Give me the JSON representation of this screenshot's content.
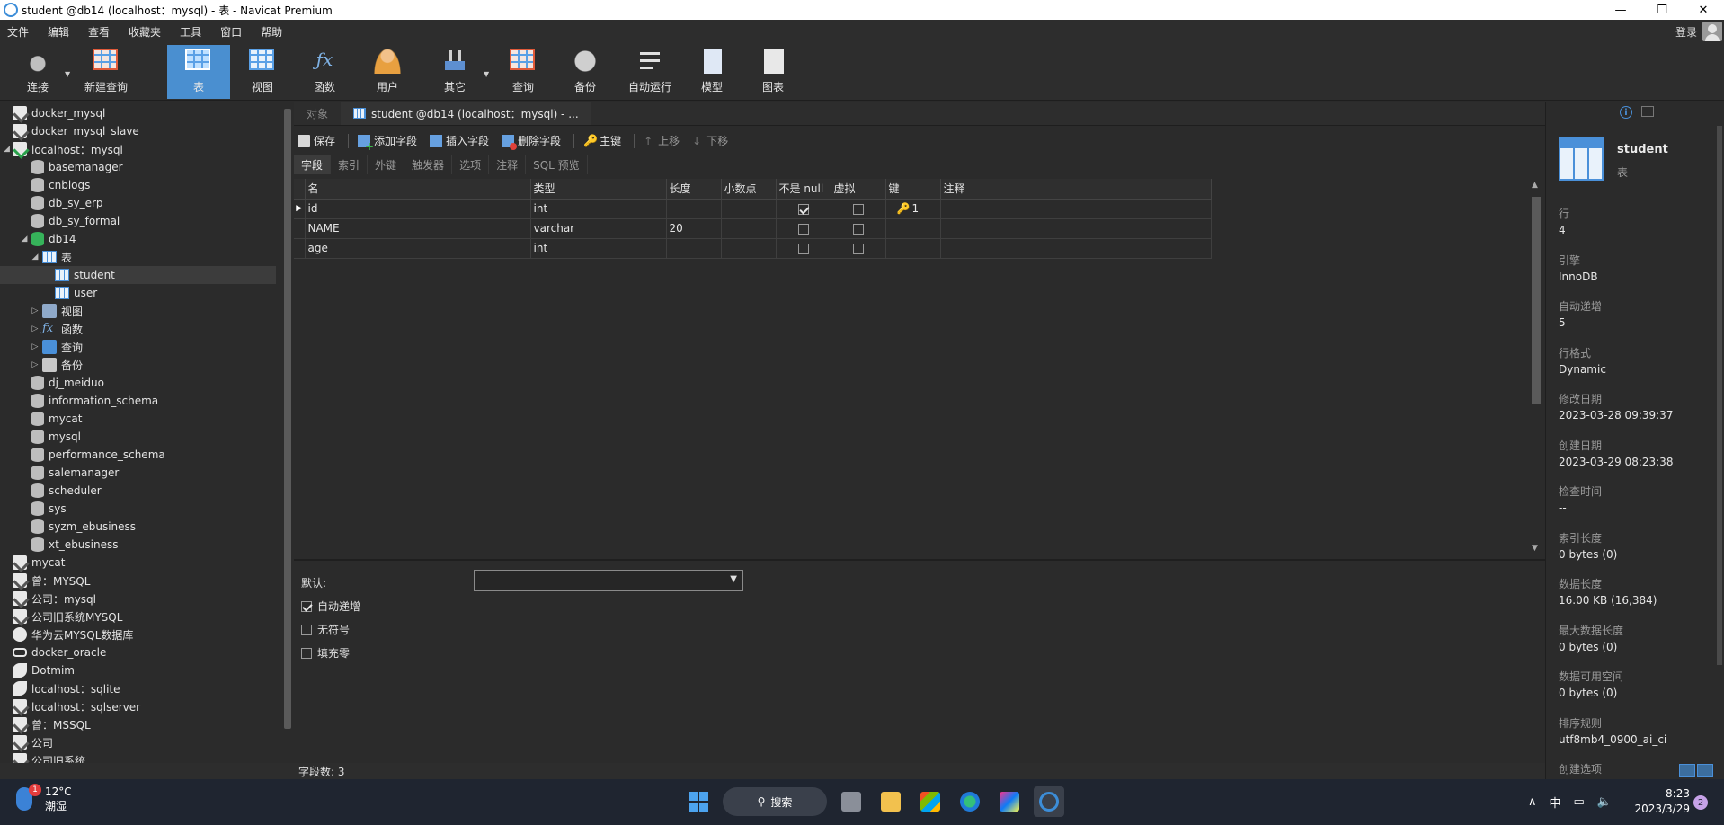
{
  "window": {
    "title": "student @db14 (localhost：mysql) - 表 - Navicat Premium",
    "minimize": "—",
    "maximize": "❐",
    "close": "✕"
  },
  "menu": {
    "items": [
      "文件",
      "编辑",
      "查看",
      "收藏夹",
      "工具",
      "窗口",
      "帮助"
    ],
    "login": "登录"
  },
  "toolbar": {
    "buttons": [
      {
        "label": "连接",
        "icon": "plug-icon"
      },
      {
        "label": "新建查询",
        "icon": "new-query-icon"
      },
      {
        "label": "表",
        "icon": "table-icon",
        "active": true
      },
      {
        "label": "视图",
        "icon": "view-icon"
      },
      {
        "label": "函数",
        "icon": "function-icon"
      },
      {
        "label": "用户",
        "icon": "user-icon"
      },
      {
        "label": "其它",
        "icon": "tools-icon"
      },
      {
        "label": "查询",
        "icon": "query-icon"
      },
      {
        "label": "备份",
        "icon": "backup-icon"
      },
      {
        "label": "自动运行",
        "icon": "automation-icon"
      },
      {
        "label": "模型",
        "icon": "model-icon"
      },
      {
        "label": "图表",
        "icon": "chart-icon"
      }
    ]
  },
  "navigator": {
    "items": [
      {
        "label": "docker_mysql",
        "icon": "mysql-connection-icon",
        "level": 0,
        "twisty": ""
      },
      {
        "label": "docker_mysql_slave",
        "icon": "mysql-connection-icon",
        "level": 0,
        "twisty": ""
      },
      {
        "label": "localhost：mysql",
        "icon": "mysql-connection-open-icon",
        "level": 0,
        "twisty": "◢"
      },
      {
        "label": "basemanager",
        "icon": "database-icon",
        "level": 1,
        "twisty": ""
      },
      {
        "label": "cnblogs",
        "icon": "database-icon",
        "level": 1,
        "twisty": ""
      },
      {
        "label": "db_sy_erp",
        "icon": "database-icon",
        "level": 1,
        "twisty": ""
      },
      {
        "label": "db_sy_formal",
        "icon": "database-icon",
        "level": 1,
        "twisty": ""
      },
      {
        "label": "db14",
        "icon": "database-open-icon",
        "level": 1,
        "twisty": "◢"
      },
      {
        "label": "表",
        "icon": "tables-folder-icon",
        "level": 2,
        "twisty": "◢"
      },
      {
        "label": "student",
        "icon": "table-icon",
        "level": 3,
        "twisty": "",
        "selected": true
      },
      {
        "label": "user",
        "icon": "table-icon",
        "level": 3,
        "twisty": ""
      },
      {
        "label": "视图",
        "icon": "views-folder-icon",
        "level": 2,
        "twisty": "▷"
      },
      {
        "label": "函数",
        "icon": "functions-folder-icon",
        "level": 2,
        "twisty": "▷"
      },
      {
        "label": "查询",
        "icon": "queries-folder-icon",
        "level": 2,
        "twisty": "▷"
      },
      {
        "label": "备份",
        "icon": "backups-folder-icon",
        "level": 2,
        "twisty": "▷"
      },
      {
        "label": "dj_meiduo",
        "icon": "database-icon",
        "level": 1,
        "twisty": ""
      },
      {
        "label": "information_schema",
        "icon": "database-icon",
        "level": 1,
        "twisty": ""
      },
      {
        "label": "mycat",
        "icon": "database-icon",
        "level": 1,
        "twisty": ""
      },
      {
        "label": "mysql",
        "icon": "database-icon",
        "level": 1,
        "twisty": ""
      },
      {
        "label": "performance_schema",
        "icon": "database-icon",
        "level": 1,
        "twisty": ""
      },
      {
        "label": "salemanager",
        "icon": "database-icon",
        "level": 1,
        "twisty": ""
      },
      {
        "label": "scheduler",
        "icon": "database-icon",
        "level": 1,
        "twisty": ""
      },
      {
        "label": "sys",
        "icon": "database-icon",
        "level": 1,
        "twisty": ""
      },
      {
        "label": "syzm_ebusiness",
        "icon": "database-icon",
        "level": 1,
        "twisty": ""
      },
      {
        "label": "xt_ebusiness",
        "icon": "database-icon",
        "level": 1,
        "twisty": ""
      },
      {
        "label": "mycat",
        "icon": "mysql-connection-icon",
        "level": 0,
        "twisty": ""
      },
      {
        "label": "曾：MYSQL",
        "icon": "mysql-connection-icon",
        "level": 0,
        "twisty": ""
      },
      {
        "label": "公司：mysql",
        "icon": "mysql-connection-icon",
        "level": 0,
        "twisty": ""
      },
      {
        "label": "公司旧系统MYSQL",
        "icon": "mysql-connection-icon",
        "level": 0,
        "twisty": ""
      },
      {
        "label": "华为云MYSQL数据库",
        "icon": "cloud-connection-icon",
        "level": 0,
        "twisty": ""
      },
      {
        "label": "docker_oracle",
        "icon": "oracle-connection-icon",
        "level": 0,
        "twisty": ""
      },
      {
        "label": "Dotmim",
        "icon": "sqlite-connection-icon",
        "level": 0,
        "twisty": ""
      },
      {
        "label": "localhost：sqlite",
        "icon": "sqlite-connection-icon",
        "level": 0,
        "twisty": ""
      },
      {
        "label": "localhost：sqlserver",
        "icon": "sqlserver-connection-icon",
        "level": 0,
        "twisty": ""
      },
      {
        "label": "曾：MSSQL",
        "icon": "sqlserver-connection-icon",
        "level": 0,
        "twisty": ""
      },
      {
        "label": "公司",
        "icon": "sqlserver-connection-icon",
        "level": 0,
        "twisty": ""
      },
      {
        "label": "公司旧系统",
        "icon": "sqlserver-connection-icon",
        "level": 0,
        "twisty": ""
      }
    ]
  },
  "tabs": {
    "objects": "对象",
    "document": "student @db14 (localhost：mysql) - ..."
  },
  "designer_toolbar": {
    "save": "保存",
    "add_field": "添加字段",
    "insert_field": "插入字段",
    "delete_field": "删除字段",
    "primary_key": "主键",
    "move_up": "上移",
    "move_down": "下移"
  },
  "subtabs": [
    "字段",
    "索引",
    "外键",
    "触发器",
    "选项",
    "注释",
    "SQL 预览"
  ],
  "fields": {
    "columns": [
      "名",
      "类型",
      "长度",
      "小数点",
      "不是 null",
      "虚拟",
      "键",
      "注释"
    ],
    "rows": [
      {
        "name": "id",
        "type": "int",
        "length": "",
        "decimals": "",
        "not_null": true,
        "virtual": false,
        "key": "1",
        "comment": "",
        "current": true
      },
      {
        "name": "NAME",
        "type": "varchar",
        "length": "20",
        "decimals": "",
        "not_null": false,
        "virtual": false,
        "key": "",
        "comment": "",
        "current": false
      },
      {
        "name": "age",
        "type": "int",
        "length": "",
        "decimals": "",
        "not_null": false,
        "virtual": false,
        "key": "",
        "comment": "",
        "current": false
      }
    ]
  },
  "field_properties": {
    "default_label": "默认:",
    "default_value": "",
    "auto_increment": {
      "label": "自动递增",
      "checked": true
    },
    "unsigned": {
      "label": "无符号",
      "checked": false
    },
    "zerofill": {
      "label": "填充零",
      "checked": false
    }
  },
  "status": {
    "field_count": "字段数: 3"
  },
  "info": {
    "name": "student",
    "type": "表",
    "props": [
      {
        "label": "行",
        "value": "4"
      },
      {
        "label": "引擎",
        "value": "InnoDB"
      },
      {
        "label": "自动递增",
        "value": "5"
      },
      {
        "label": "行格式",
        "value": "Dynamic"
      },
      {
        "label": "修改日期",
        "value": "2023-03-28 09:39:37"
      },
      {
        "label": "创建日期",
        "value": "2023-03-29 08:23:38"
      },
      {
        "label": "检查时间",
        "value": "--"
      },
      {
        "label": "索引长度",
        "value": "0 bytes (0)"
      },
      {
        "label": "数据长度",
        "value": "16.00 KB (16,384)"
      },
      {
        "label": "最大数据长度",
        "value": "0 bytes (0)"
      },
      {
        "label": "数据可用空间",
        "value": "0 bytes (0)"
      },
      {
        "label": "排序规则",
        "value": "utf8mb4_0900_ai_ci"
      },
      {
        "label": "创建选项",
        "value": ""
      }
    ]
  },
  "taskbar": {
    "weather_badge": "1",
    "temperature": "12°C",
    "weather": "潮湿",
    "search": "搜索",
    "ime": "中",
    "time": "8:23",
    "date": "2023/3/29",
    "notifications": "2"
  },
  "colors": {
    "accent": "#4a8fd0",
    "background": "#2b2b2b",
    "key_icon": "#f0b400"
  }
}
